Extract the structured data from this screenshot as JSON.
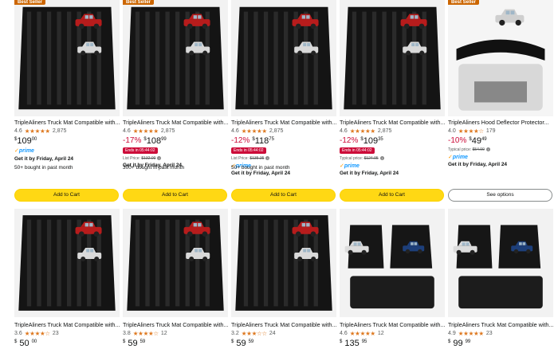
{
  "row1": [
    {
      "badge": "Best Seller",
      "title": "TripleAliners Truck Mat Compatible with...",
      "rating": "4.6",
      "stars": "★★★★★",
      "reviews": "2,875",
      "discount": "",
      "price_whole": "109",
      "price_cents": "00",
      "deal": "",
      "list_price_label": "",
      "list_price": "",
      "prime": "prime",
      "delivery": "Get it by Friday, April 24",
      "bought": "50+ bought in past month",
      "button": "Add to Cart"
    },
    {
      "badge": "Best Seller",
      "title": "TripleAliners Truck Mat Compatible with...",
      "rating": "4.6",
      "stars": "★★★★★",
      "reviews": "2,875",
      "discount": "-17%",
      "price_whole": "108",
      "price_cents": "99",
      "deal": "Ends in 05:44:02",
      "list_price_label": "List Price:",
      "list_price": "$132.00",
      "prime": "",
      "delivery": "Get it by Friday, April 24",
      "bought": "300+ bought in past month",
      "button": "Add to Cart"
    },
    {
      "badge": "",
      "title": "TripleAliners Truck Mat Compatible with...",
      "rating": "4.6",
      "stars": "★★★★★",
      "reviews": "2,875",
      "discount": "-12%",
      "price_whole": "118",
      "price_cents": "75",
      "deal": "Ends in 05:44:02",
      "list_price_label": "List Price:",
      "list_price": "$135.35",
      "prime": "prime",
      "delivery": "Get it by Friday, April 24",
      "bought": "50+ bought in past month",
      "button": "Add to Cart"
    },
    {
      "badge": "",
      "title": "TripleAliners Truck Mat Compatible with...",
      "rating": "4.6",
      "stars": "★★★★★",
      "reviews": "2,875",
      "discount": "-12%",
      "price_whole": "109",
      "price_cents": "35",
      "deal": "Ends in 05:44:02",
      "list_price_label": "Typical price:",
      "list_price": "$124.95",
      "prime": "prime",
      "delivery": "Get it by Friday, April 24",
      "bought": "",
      "button": "Add to Cart"
    },
    {
      "badge": "Best Seller",
      "title": "TripleAliners Hood Deflector Protector...",
      "rating": "4.0",
      "stars": "★★★★☆",
      "reviews": "179",
      "discount": "-10%",
      "price_whole": "49",
      "price_cents": "49",
      "deal": "",
      "list_price_label": "Typical price:",
      "list_price": "$54.99",
      "prime": "prime",
      "delivery": "Get it by Friday, April 24",
      "bought": "",
      "button": "See options"
    }
  ],
  "row2": [
    {
      "title": "TripleAliners Truck Mat Compatible with...",
      "rating": "3.6",
      "stars": "★★★★☆",
      "reviews": "23",
      "price_whole": "50",
      "price_cents": "00"
    },
    {
      "title": "TripleAliners Truck Mat Compatible with...",
      "rating": "3.8",
      "stars": "★★★★☆",
      "reviews": "12",
      "price_whole": "59",
      "price_cents": "59"
    },
    {
      "title": "TripleAliners Truck Mat Compatible with...",
      "rating": "3.2",
      "stars": "★★★☆☆",
      "reviews": "24",
      "price_whole": "59",
      "price_cents": "59"
    },
    {
      "title": "TripleAliners Truck Mat Compatible with...",
      "rating": "4.6",
      "stars": "★★★★★",
      "reviews": "12",
      "price_whole": "135",
      "price_cents": "95"
    },
    {
      "title": "TripleAliners Truck Mat Compatible with...",
      "rating": "4.9",
      "stars": "★★★★★",
      "reviews": "23",
      "price_whole": "99",
      "price_cents": "99"
    }
  ],
  "colors": {
    "button_yellow": "#ffd814",
    "deal_red": "#cc0c39",
    "star_orange": "#de7921",
    "prime_blue": "#1399ff",
    "badge_orange": "#cc6600"
  },
  "icons": {
    "product_image": "product-image",
    "prime": "prime-check-icon",
    "info": "info-icon"
  }
}
